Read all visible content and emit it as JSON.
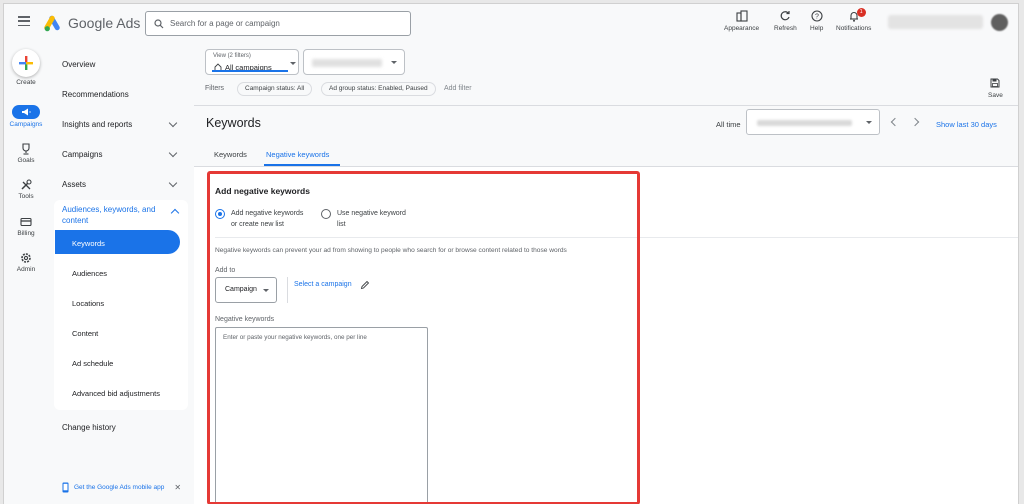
{
  "app": {
    "title": "Google Ads"
  },
  "search": {
    "placeholder": "Search for a page or campaign"
  },
  "topbar": {
    "appearance": "Appearance",
    "refresh": "Refresh",
    "help": "Help",
    "notifications": "Notifications",
    "notification_count": "1"
  },
  "rail": {
    "create": "Create",
    "campaigns": "Campaigns",
    "goals": "Goals",
    "tools": "Tools",
    "billing": "Billing",
    "admin": "Admin"
  },
  "nav": {
    "overview": "Overview",
    "recommendations": "Recommendations",
    "insights": "Insights and reports",
    "campaigns": "Campaigns",
    "assets": "Assets",
    "audiences_group": "Audiences, keywords, and content",
    "sub": [
      "Keywords",
      "Audiences",
      "Locations",
      "Content",
      "Ad schedule",
      "Advanced bid adjustments"
    ],
    "change_history": "Change history",
    "mobile_app": "Get the Google Ads mobile app"
  },
  "filters": {
    "view_small": "View (2 filters)",
    "view_value": "All campaigns",
    "label": "Filters",
    "chip1": "Campaign status: All",
    "chip2": "Ad group status: Enabled, Paused",
    "add_filter": "Add filter",
    "save": "Save"
  },
  "page": {
    "title": "Keywords",
    "all_time": "All time",
    "show_last": "Show last 30 days",
    "tabs": [
      "Keywords",
      "Negative keywords"
    ]
  },
  "panel": {
    "title": "Add negative keywords",
    "radio1_line1": "Add negative keywords",
    "radio1_line2": "or create new list",
    "radio2_line1": "Use negative keyword",
    "radio2_line2": "list",
    "info": "Negative keywords can prevent your ad from showing to people who search for or browse content related to those words",
    "add_to": "Add to",
    "campaign_btn": "Campaign",
    "select_campaign": "Select a campaign",
    "neg_label": "Negative keywords",
    "textarea_placeholder": "Enter or paste your negative keywords, one per line"
  },
  "colors": {
    "accent": "#1a73e8",
    "highlight": "#e53935"
  }
}
